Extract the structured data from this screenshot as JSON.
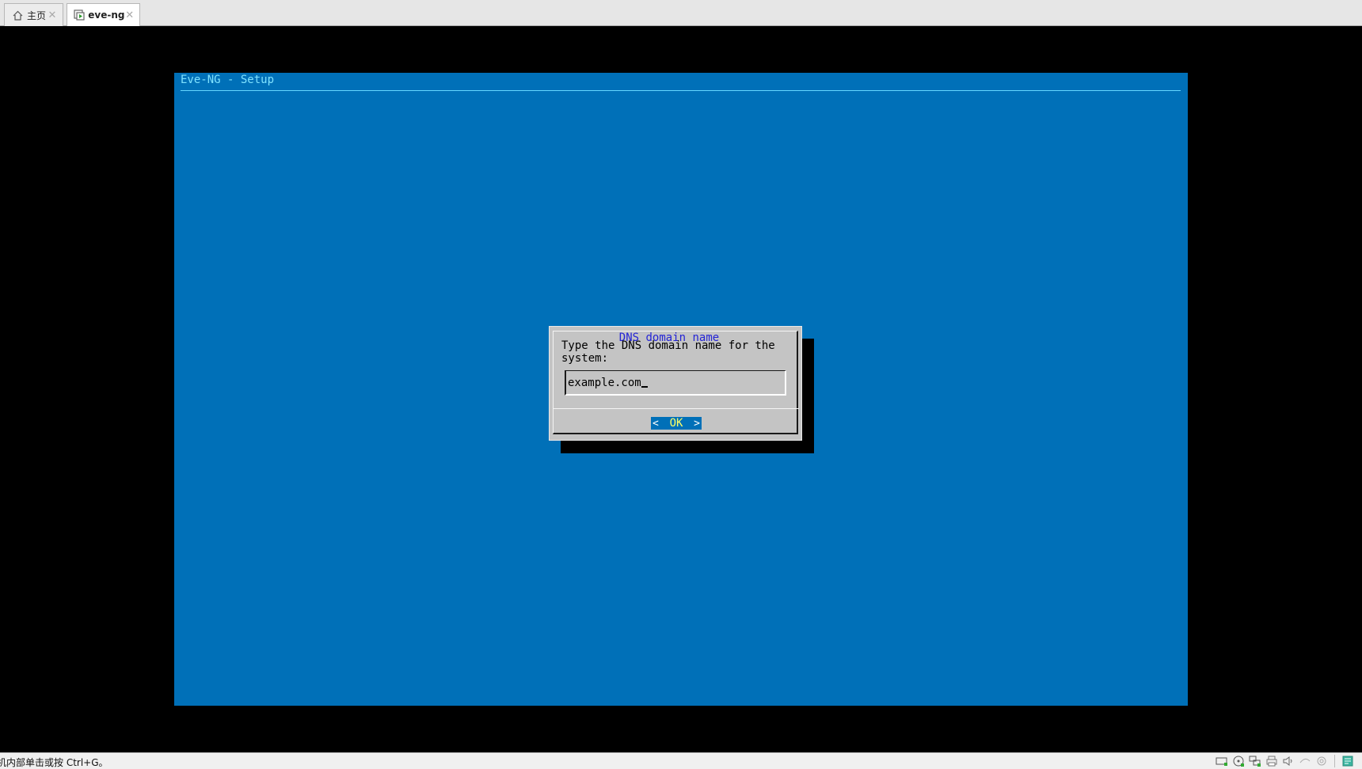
{
  "tabs": [
    {
      "label": "主页",
      "icon": "home-icon",
      "active": false
    },
    {
      "label": "eve-ng",
      "icon": "vm-icon",
      "active": true
    }
  ],
  "console": {
    "backtitle": "Eve-NG - Setup",
    "dialog": {
      "title": "DNS domain name",
      "prompt": "Type the DNS domain name for the system:",
      "input_value": "example.com",
      "ok_label": "OK",
      "left_bracket": "<",
      "right_bracket": ">"
    }
  },
  "statusbar": {
    "text": "机内部单击或按 Ctrl+G。",
    "icons": [
      "hard-disk-icon",
      "cd-dvd-icon",
      "network-adapter-icon",
      "printer-icon",
      "sound-icon",
      "usb-icon",
      "display-icon",
      "message-icon"
    ]
  },
  "colors": {
    "console_background": "#0070b8",
    "dialog_background": "#c4c4c4",
    "backtitle_color": "#7fe2ff",
    "dialog_title_color": "#2424d6",
    "button_label_color": "#ffff66"
  }
}
